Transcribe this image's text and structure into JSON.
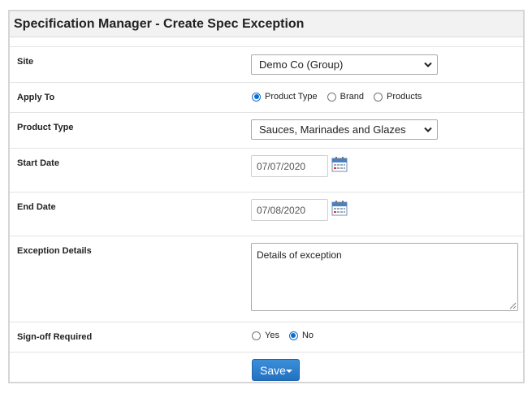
{
  "header": {
    "title": "Specification Manager - Create Spec Exception"
  },
  "form": {
    "site": {
      "label": "Site",
      "value": "Demo Co (Group)"
    },
    "apply_to": {
      "label": "Apply To",
      "options": [
        {
          "label": "Product Type",
          "checked": true
        },
        {
          "label": "Brand",
          "checked": false
        },
        {
          "label": "Products",
          "checked": false
        }
      ]
    },
    "product_type": {
      "label": "Product Type",
      "value": "Sauces, Marinades and Glazes"
    },
    "start_date": {
      "label": "Start Date",
      "value": "07/07/2020"
    },
    "end_date": {
      "label": "End Date",
      "value": "07/08/2020"
    },
    "exception_details": {
      "label": "Exception Details",
      "value": "Details of exception"
    },
    "signoff": {
      "label": "Sign-off Required",
      "options": [
        {
          "label": "Yes",
          "checked": false
        },
        {
          "label": "No",
          "checked": true
        }
      ]
    },
    "save_label": "Save"
  },
  "icons": {
    "select_arrow": "chevron-down-icon",
    "date_picker": "calendar-icon",
    "save_dropdown": "caret-down-icon"
  },
  "colors": {
    "accent": "#0a6ed1",
    "button": "#2a7ccc"
  }
}
